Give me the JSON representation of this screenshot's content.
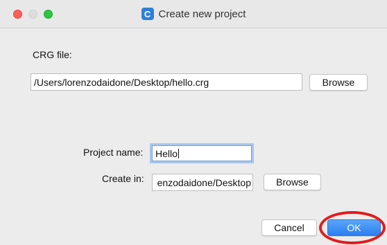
{
  "window": {
    "title": "Create new project",
    "app_icon_letter": "C"
  },
  "crg": {
    "label": "CRG file:",
    "path_value": "/Users/lorenzodaidone/Desktop/hello.crg",
    "browse_label": "Browse"
  },
  "project": {
    "name_label": "Project name:",
    "name_value": "Hello",
    "create_in_label": "Create in:",
    "create_in_visible_value": "enzodaidone/Desktop",
    "browse_label": "Browse"
  },
  "footer": {
    "cancel_label": "Cancel",
    "ok_label": "OK"
  },
  "colors": {
    "ok_button": "#2a7ff2",
    "annotation_ring": "#e21b1b",
    "focus_ring": "#a7c6ef"
  }
}
